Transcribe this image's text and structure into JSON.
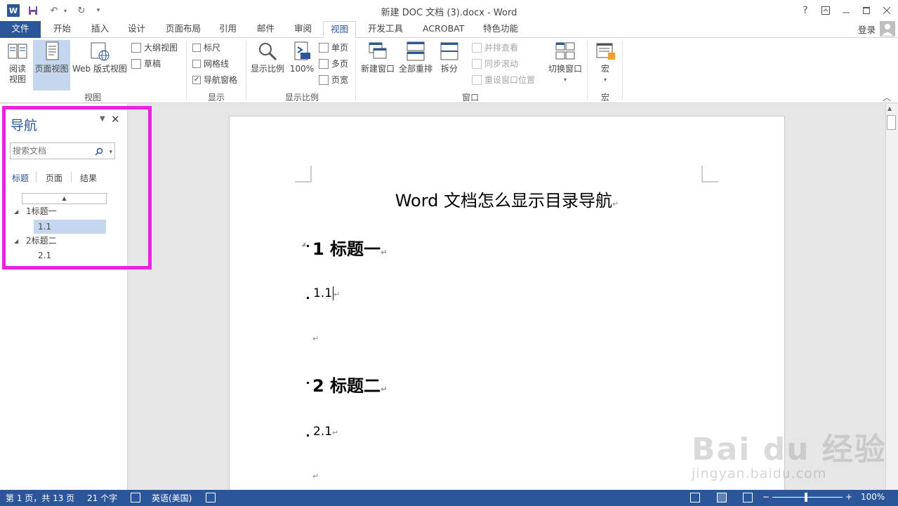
{
  "app": {
    "title": "新建 DOC 文档 (3).docx - Word",
    "window_controls": {
      "help": "?",
      "ribbon_display": "⧈",
      "minimize": "—",
      "maximize": "☐",
      "close": "✕"
    }
  },
  "tabs": {
    "file": "文件",
    "items": [
      "开始",
      "插入",
      "设计",
      "页面布局",
      "引用",
      "邮件",
      "审阅",
      "视图",
      "开发工具",
      "ACROBAT",
      "特色功能"
    ],
    "active": "视图",
    "login": "登录"
  },
  "ribbon": {
    "views": {
      "label": "视图",
      "read_mode": "阅读\n视图",
      "read_mode_line1": "阅读",
      "read_mode_line2": "视图",
      "print_layout": "页面视图",
      "web_layout": "Web 版式视图",
      "outline": "大纲视图",
      "draft": "草稿"
    },
    "show": {
      "label": "显示",
      "ruler": "标尺",
      "gridlines": "网格线",
      "nav_pane": "导航窗格",
      "ruler_checked": false,
      "gridlines_checked": false,
      "nav_pane_checked": true
    },
    "zoom": {
      "label": "显示比例",
      "zoom": "显示比例",
      "hundred": "100%",
      "one_page": "单页",
      "multi_page": "多页",
      "page_width": "页宽"
    },
    "window": {
      "label": "窗口",
      "new_window": "新建窗口",
      "arrange_all": "全部重排",
      "split": "拆分",
      "side_by_side": "并排查看",
      "sync_scroll": "同步滚动",
      "reset_position": "重设窗口位置",
      "switch_windows": "切换窗口"
    },
    "macros": {
      "label": "宏",
      "macros": "宏"
    }
  },
  "nav_pane": {
    "title": "导航",
    "search_placeholder": "搜索文档",
    "tabs": [
      "标题",
      "页面",
      "结果"
    ],
    "tree": [
      {
        "label": "1标题一",
        "level": 1,
        "expanded": true
      },
      {
        "label": "1.1",
        "level": 2,
        "selected": true
      },
      {
        "label": "2标题二",
        "level": 1,
        "expanded": true
      },
      {
        "label": "2.1",
        "level": 2
      }
    ],
    "highlight_color": "#e923e0"
  },
  "document": {
    "title": "Word 文档怎么显示目录导航",
    "h1a": "1 标题一",
    "p1": "1.1",
    "h1b": "2 标题二",
    "p2": "2.1",
    "para_mark": "↵"
  },
  "status": {
    "page": "第 1 页，共 13 页",
    "words": "21 个字",
    "language": "英语(美国)",
    "zoom": "100%",
    "zoom_minus": "−",
    "zoom_plus": "+"
  },
  "watermark": {
    "main": "Bai du 经验",
    "sub": "jingyan.baidu.com"
  },
  "colors": {
    "accent": "#2b579a",
    "selection": "#c5d7ef",
    "highlight": "#e923e0"
  }
}
